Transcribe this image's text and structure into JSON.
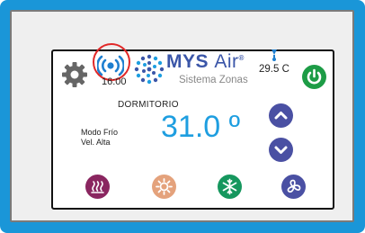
{
  "device": {
    "clock": "16:00",
    "brand_name": "MYS",
    "brand_suffix": "Air",
    "brand_mark": "®",
    "subtitle": "Sistema Zonas",
    "outdoor_temp": "29.5 C",
    "zone_name": "DORMITORIO",
    "mode_line": "Modo Frío",
    "fan_line": "Vel. Alta",
    "setpoint": "31.0 º"
  },
  "icons": {
    "settings": "gear-icon",
    "wifi": "wifi-signal-icon",
    "outdoor": "thermometer-icon",
    "power": "power-icon",
    "temp_up": "chevron-up-icon",
    "temp_down": "chevron-down-icon",
    "heat": "heat-waves-icon",
    "sun": "sun-icon",
    "cool": "snowflake-icon",
    "fan": "fan-icon"
  },
  "colors": {
    "bezel": "#1a96d8",
    "setpoint_text": "#1e9ee0",
    "power": "#1d9c46",
    "arrows": "#4a50a3",
    "heat": "#8a2660",
    "sun": "#e4a27c",
    "cool": "#16975e",
    "fan": "#4a50a3",
    "highlight_ring": "#e12828"
  }
}
